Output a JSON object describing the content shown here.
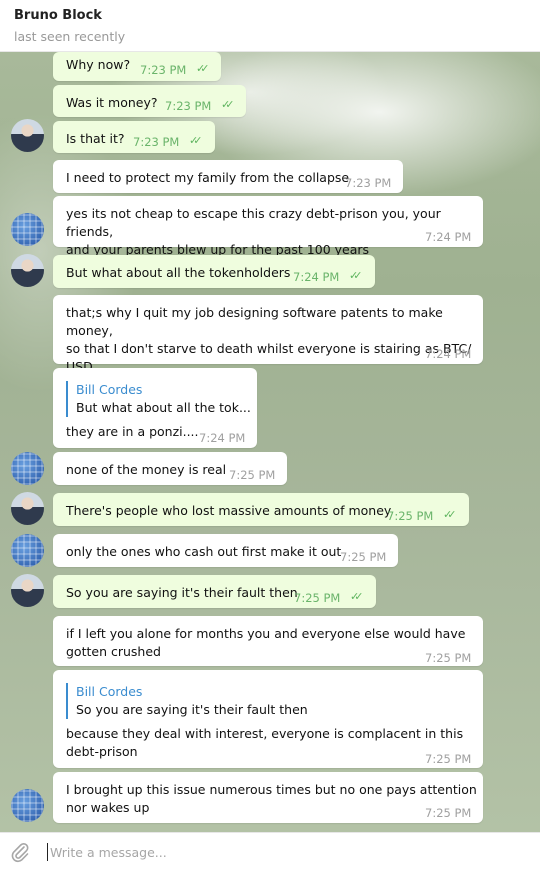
{
  "header": {
    "name": "Bruno Block",
    "status": "last seen recently"
  },
  "composer": {
    "placeholder": "Write a message..."
  },
  "messages": [
    {
      "text": "Why now?",
      "time": "7:23 PM"
    },
    {
      "text": "Was it money?",
      "time": "7:23 PM"
    },
    {
      "text": "Is that it?",
      "time": "7:23 PM"
    },
    {
      "text": "I need to protect my family from the collapse",
      "time": "7:23 PM"
    },
    {
      "line1": "yes its not cheap to escape this crazy debt-prison you, your friends,",
      "line2": "and your parents blew up for the past 100 years",
      "time": "7:24 PM"
    },
    {
      "text": "But what about all the tokenholders",
      "time": "7:24 PM"
    },
    {
      "line1": "that;s why I quit my job designing software patents to make money,",
      "line2": "so that I don't starve to death whilst everyone is stairing as BTC/",
      "line3": "USD",
      "time": "7:24 PM"
    },
    {
      "quote_name": "Bill Cordes",
      "quote_text": "But what about all the tok...",
      "text": "they are in a ponzi....",
      "time": "7:24 PM"
    },
    {
      "text": "none of the money is real",
      "time": "7:25 PM"
    },
    {
      "text": "There's people who lost massive amounts of money",
      "time": "7:25 PM"
    },
    {
      "text": "only the ones who cash out first make it out",
      "time": "7:25 PM"
    },
    {
      "text": "So you are saying it's their fault then",
      "time": "7:25 PM"
    },
    {
      "line1": "if I left you alone for months you and everyone else would have",
      "line2": "gotten crushed",
      "time": "7:25 PM"
    },
    {
      "quote_name": "Bill Cordes",
      "quote_text": "So you are saying it's their fault then",
      "line1": "because they deal with interest, everyone is complacent in this",
      "line2": "debt-prison",
      "time": "7:25 PM"
    },
    {
      "line1": "I brought up this issue numerous times but no one pays attention",
      "line2": "nor wakes up",
      "time": "7:25 PM"
    }
  ]
}
